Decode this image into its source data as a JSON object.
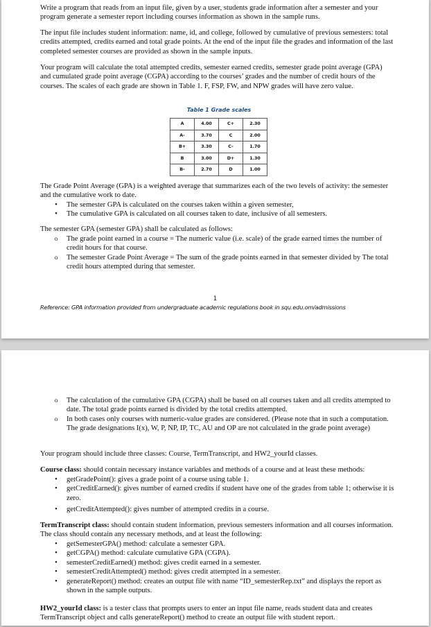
{
  "page1": {
    "intro_paragraphs": [
      "Write a program that reads from an input file, given by a user, students grade information after a semester and your program generate a semester report including courses information as shown in the sample runs.",
      "The input file includes student information: name, id, and college, followed by cumulative of previous semesters: total credits attempted, credits earned and total grade points. At the end of the input file the grades and information of the last completed semester courses are provided as shown in the sample inputs.",
      "Your program will calculate the total attempted credits, semester earned credits, semester grade point average (GPA) and cumulated grade point average (CGPA) according to the courses’ grades and the number of credit hours of the courses. The scales of each grade are shown in Table 1. F, FSP, FW, and NPW grades will have zero value."
    ],
    "table": {
      "caption": "Table 1 Grade scales",
      "rows": [
        [
          "A",
          "4.00",
          "C+",
          "2.30"
        ],
        [
          "A-",
          "3.70",
          "C",
          "2.00"
        ],
        [
          "B+",
          "3.30",
          "C-",
          "1.70"
        ],
        [
          "B",
          "3.00",
          "D+",
          "1.30"
        ],
        [
          "B-",
          "2.70",
          "D",
          "1.00"
        ]
      ]
    },
    "gpa_paragraph": "The Grade Point Average (GPA) is a weighted average that summarizes each of the two levels of activity: the semester and the cumulative work to date.",
    "gpa_bullets": [
      "The semester GPA is calculated on the courses taken within a given semester,",
      "The cumulative GPA is calculated on all courses taken to date, inclusive of all semesters."
    ],
    "semester_gpa_heading": "The semester GPA (semester GPA) shall be calculated as follows:",
    "semester_gpa_items": [
      "The grade point earned in a course = The numeric value (i.e. scale) of the grade earned times the number of credit hours for that course.",
      "The semester Grade Point Average = The sum of the grade points earned in that semester divided by The total credit hours attempted during that semester."
    ],
    "page_number": "1",
    "reference": "Reference: GPA information provided from undergraduate academic regulations book in squ.edu.om/admissions"
  },
  "page2": {
    "cgpa_items": [
      "The calculation of the cumulative GPA (CGPA) shall be based on all courses taken and all credits attempted to date.  The total grade points earned is divided by the total credits attempted.",
      "In both cases only courses with numeric-value grades are considered. (Please note that in such a computation. The grade designations I(x), W, P, NP, IP, TC, AU and OP are not calculated in the grade point average)"
    ],
    "classes_intro": "Your program should include three classes: Course, TermTranscript, and HW2_yourId classes.",
    "course_class": {
      "title": "Course class:",
      "text": " should contain necessary instance variables and methods of a course and at least these methods:",
      "methods": [
        "getGradePoint(): gives a grade point of a course using table 1.",
        "getCreditEarned(): gives number of earned credits if student have one of the grades from table 1; otherwise it is zero.",
        "getCreditAttempted(): gives number of attempted credits in a course."
      ]
    },
    "term_class": {
      "title": "TermTranscript class:",
      "text": " should contain student information, previous semesters information and all courses information. The class should contain any necessary methods, and at least the following:",
      "methods": [
        "getSemesterGPA() method: calculate a semester GPA.",
        "getCGPA() method: calculate cumulative GPA (CGPA).",
        "semesterCreditEarned() method: gives credit earned in a semester.",
        "semesterCreditAttempted() method: gives credit attempted in a semester.",
        "generateReport() method: creates an output file with name “ID_semesterRep.txt” and displays the report as shown in the sample outputs."
      ]
    },
    "hw2_class": {
      "title": "HW2_yourId class:",
      "text": " is a tester class that prompts users to enter an input file name, reads student data and creates TermTranscript object and calls generateReport() method to create an output file with student report."
    }
  },
  "icons": {
    "bullet": "•",
    "circle": "o"
  }
}
